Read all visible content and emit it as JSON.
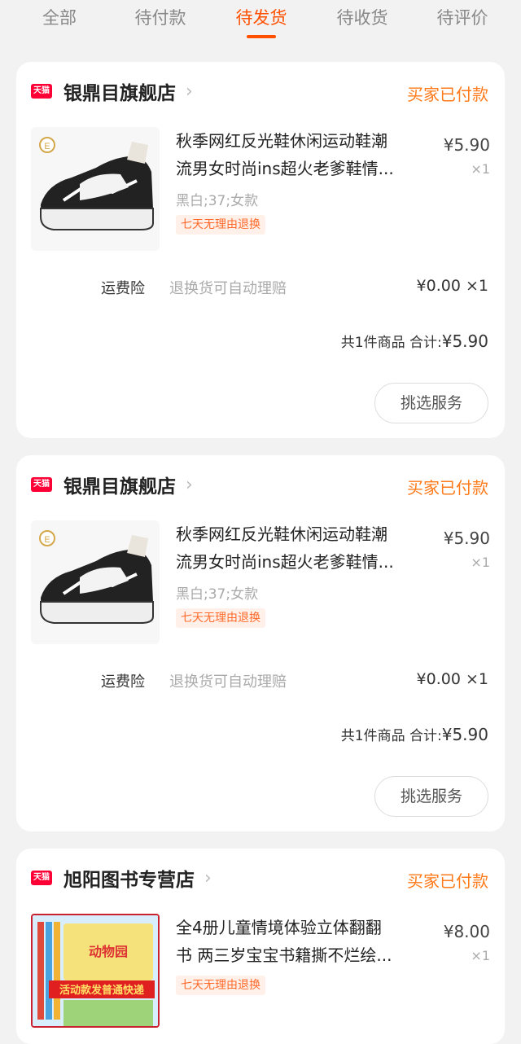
{
  "tabs": [
    {
      "label": "全部"
    },
    {
      "label": "待付款"
    },
    {
      "label": "待发货"
    },
    {
      "label": "待收货"
    },
    {
      "label": "待评价"
    }
  ],
  "orders": [
    {
      "logo": "天猫",
      "shop": "银鼎目旗舰店",
      "status": "买家已付款",
      "item": {
        "title_line1": "秋季网红反光鞋休闲运动鞋潮",
        "title_line2": "流男女时尚ins超火老爹鞋情...",
        "sku": "黑白;37;女款",
        "tag": "七天无理由退换",
        "price": "¥5.90",
        "qty": "×1",
        "icon": "sneaker-image"
      },
      "insurance": {
        "label": "运费险",
        "desc": "退换货可自动理赔",
        "price": "¥0.00 ×1"
      },
      "summary": {
        "count_text": "共1件商品",
        "total_label": "合计:",
        "total": "¥5.90"
      },
      "button": "挑选服务"
    },
    {
      "logo": "天猫",
      "shop": "银鼎目旗舰店",
      "status": "买家已付款",
      "item": {
        "title_line1": "秋季网红反光鞋休闲运动鞋潮",
        "title_line2": "流男女时尚ins超火老爹鞋情...",
        "sku": "黑白;37;女款",
        "tag": "七天无理由退换",
        "price": "¥5.90",
        "qty": "×1",
        "icon": "sneaker-image"
      },
      "insurance": {
        "label": "运费险",
        "desc": "退换货可自动理赔",
        "price": "¥0.00 ×1"
      },
      "summary": {
        "count_text": "共1件商品",
        "total_label": "合计:",
        "total": "¥5.90"
      },
      "button": "挑选服务"
    },
    {
      "logo": "天猫",
      "shop": "旭阳图书专营店",
      "status": "买家已付款",
      "item": {
        "title_line1": "全4册儿童情境体验立体翻翻",
        "title_line2": "书 两三岁宝宝书籍撕不烂绘...",
        "tag": "七天无理由退换",
        "price": "¥8.00",
        "qty": "×1",
        "icon": "book-image",
        "cover_text": "动物园",
        "banner_text": "活动款发普通快递"
      }
    }
  ],
  "colors": {
    "accent": "#ff5000",
    "status": "#ff7a1a",
    "tmall": "#ff0036"
  }
}
